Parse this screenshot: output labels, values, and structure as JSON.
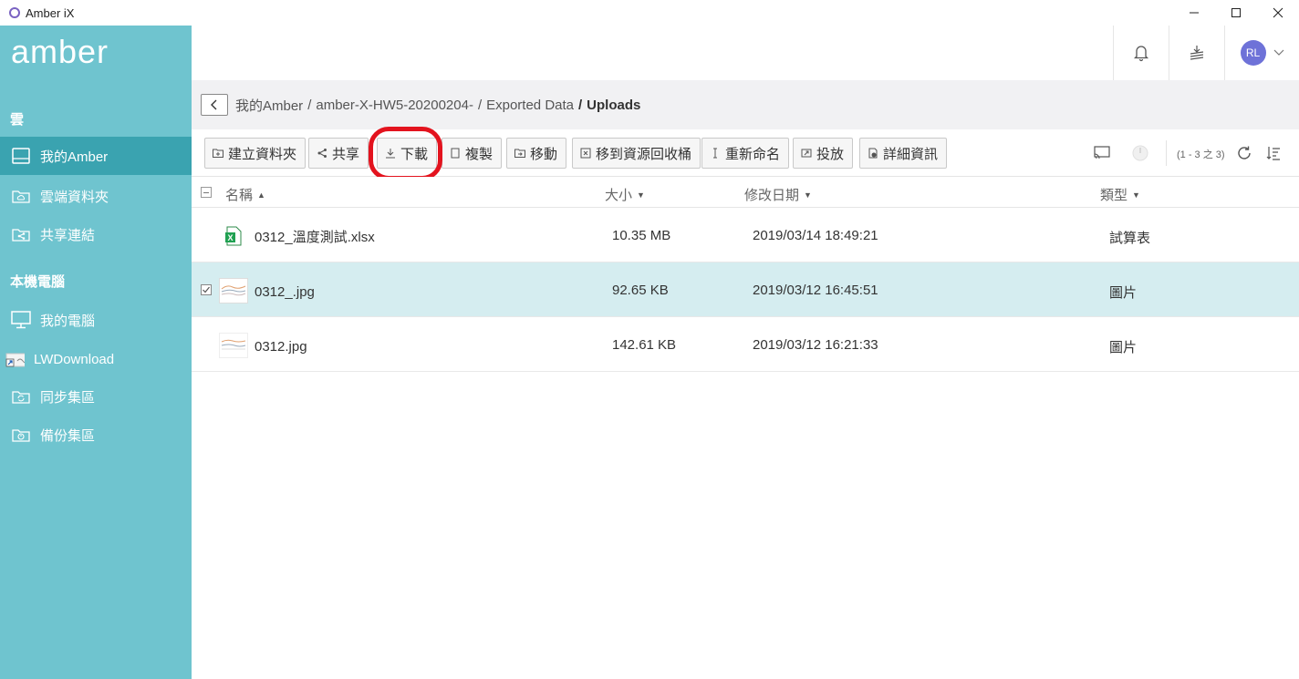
{
  "window": {
    "title": "Amber iX"
  },
  "sidebar": {
    "logo": "amber",
    "cloud_section": "雲",
    "local_section": "本機電腦",
    "cloud_items": [
      {
        "label": "我的Amber",
        "icon": "drive-icon",
        "active": true
      },
      {
        "label": "雲端資料夾",
        "icon": "cloud-folder-icon",
        "active": false
      },
      {
        "label": "共享連結",
        "icon": "share-link-icon",
        "active": false
      }
    ],
    "local_items": [
      {
        "label": "我的電腦",
        "icon": "monitor-icon"
      },
      {
        "label": "LWDownload",
        "icon": "folder-shortcut-icon"
      },
      {
        "label": "同步集區",
        "icon": "sync-folder-icon"
      },
      {
        "label": "備份集區",
        "icon": "backup-folder-icon"
      }
    ]
  },
  "header": {
    "avatar_initials": "RL"
  },
  "breadcrumb": {
    "parts": [
      "我的Amber",
      "amber-X-HW5-20200204-",
      "Exported Data"
    ],
    "current": "Uploads",
    "separator": "/"
  },
  "toolbar": {
    "new_folder": "建立資料夾",
    "share": "共享",
    "download": "下載",
    "copy": "複製",
    "move": "移動",
    "recycle": "移到資源回收桶",
    "rename": "重新命名",
    "cast": "投放",
    "details": "詳細資訊",
    "pager": "(1 - 3 之 3)"
  },
  "table": {
    "columns": {
      "name": "名稱",
      "size": "大小",
      "modified": "修改日期",
      "type": "類型"
    },
    "rows": [
      {
        "name": "0312_溫度測試.xlsx",
        "size": "10.35 MB",
        "modified": "2019/03/14 18:49:21",
        "type": "試算表",
        "icon": "excel-file-icon",
        "selected": false
      },
      {
        "name": "0312_.jpg",
        "size": "92.65 KB",
        "modified": "2019/03/12 16:45:51",
        "type": "圖片",
        "icon": "image-thumbnail-icon",
        "selected": true
      },
      {
        "name": "0312.jpg",
        "size": "142.61 KB",
        "modified": "2019/03/12 16:21:33",
        "type": "圖片",
        "icon": "image-thumbnail-icon",
        "selected": false
      }
    ]
  },
  "colors": {
    "sidebar": "#6fc4cf",
    "sidebar_active": "#3aa3b0",
    "selected_row": "#d5edf0",
    "highlight": "#e3131e",
    "avatar": "#6e72d8"
  }
}
